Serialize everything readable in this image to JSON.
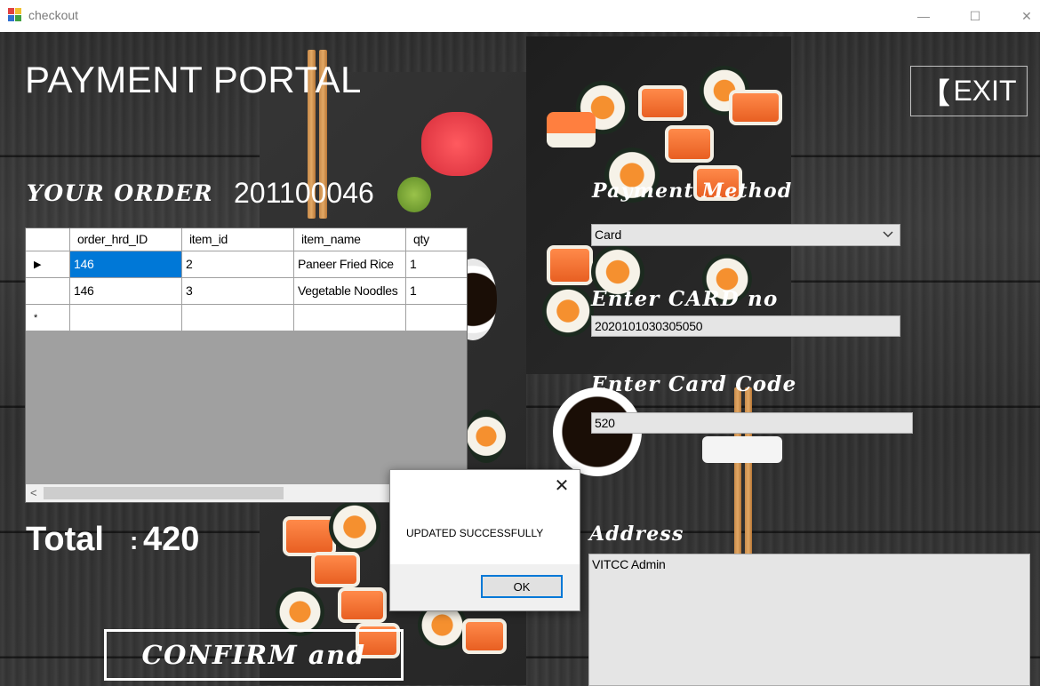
{
  "window": {
    "title": "checkout",
    "controls": {
      "minimize": "—",
      "maximize": "☐",
      "close": "✕"
    }
  },
  "colors": {
    "selected_cell": "#0078d7",
    "field_bg": "#e5e5e5",
    "text_on_bg": "#ffffff"
  },
  "header": {
    "title": "PAYMENT PORTAL",
    "exit_bracket": "【",
    "exit_label": "EXIT"
  },
  "order": {
    "label": "YOUR ORDER",
    "order_id": "201100046",
    "grid": {
      "columns": [
        "order_hrd_ID",
        "item_id",
        "item_name",
        "qty"
      ],
      "rows": [
        {
          "order_hrd_ID": "146",
          "item_id": "2",
          "item_name": "Paneer Fried Rice",
          "qty": "1"
        },
        {
          "order_hrd_ID": "146",
          "item_id": "3",
          "item_name": "Vegetable Noodles",
          "qty": "1"
        }
      ],
      "current_row_marker": "▶",
      "new_row_marker": "*",
      "scroll_left": "<"
    }
  },
  "total": {
    "label": "Total",
    "colon": ":",
    "value": "420"
  },
  "confirm": {
    "label": "CONFIRM and"
  },
  "payment": {
    "method_label": "Payment Method",
    "method_value": "Card",
    "card_no_label": "Enter CARD no",
    "card_no_value": "2020101030305050",
    "card_code_label": "Enter Card Code",
    "card_code_value": "520",
    "address_label": "Address",
    "address_value": "VITCC Admin"
  },
  "dialog": {
    "message": "UPDATED SUCCESSFULLY",
    "ok_label": "OK",
    "close_glyph": "✕"
  }
}
